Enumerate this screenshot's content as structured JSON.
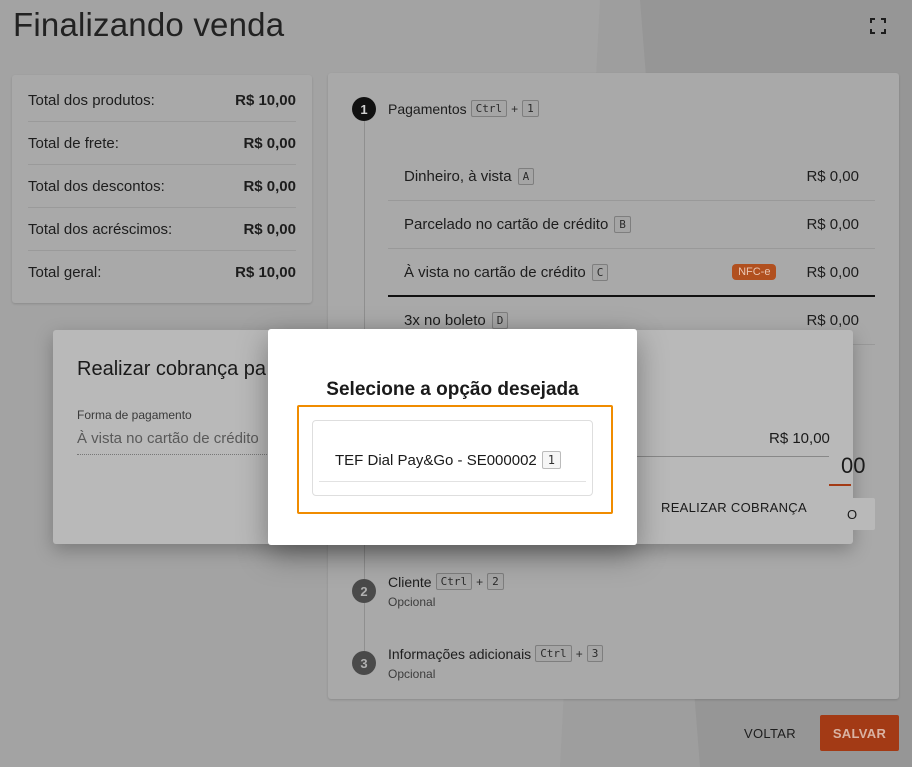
{
  "page": {
    "title": "Finalizando venda"
  },
  "summary": {
    "rows": [
      {
        "label": "Total dos produtos:",
        "value": "R$ 10,00"
      },
      {
        "label": "Total de frete:",
        "value": "R$ 0,00"
      },
      {
        "label": "Total dos descontos:",
        "value": "R$ 0,00"
      },
      {
        "label": "Total dos acréscimos:",
        "value": "R$ 0,00"
      },
      {
        "label": "Total geral:",
        "value": "R$ 10,00"
      }
    ]
  },
  "steps": {
    "payments": {
      "number": "1",
      "title": "Pagamentos",
      "shortcut_key": "Ctrl",
      "shortcut_plus": "+",
      "shortcut_num": "1"
    },
    "client": {
      "number": "2",
      "title": "Cliente",
      "shortcut_key": "Ctrl",
      "shortcut_plus": "+",
      "shortcut_num": "2",
      "subtitle": "Opcional"
    },
    "additional": {
      "number": "3",
      "title": "Informações adicionais",
      "shortcut_key": "Ctrl",
      "shortcut_plus": "+",
      "shortcut_num": "3",
      "subtitle": "Opcional"
    }
  },
  "payment_methods": [
    {
      "label": "Dinheiro, à vista",
      "key": "A",
      "amount": "R$ 0,00"
    },
    {
      "label": "Parcelado no cartão de crédito",
      "key": "B",
      "amount": "R$ 0,00"
    },
    {
      "label": "À vista no cartão de crédito",
      "key": "C",
      "amount": "R$ 0,00",
      "badge": "NFC-e"
    },
    {
      "label": "3x no boleto",
      "key": "D",
      "amount": "R$ 0,00"
    }
  ],
  "charge_dialog": {
    "title": "Realizar cobrança pa",
    "field_label": "Forma de pagamento",
    "field_value": "À vista no cartão de crédito",
    "amount": "R$ 10,00",
    "peek_value": "00",
    "peek_btn": "O",
    "action": "REALIZAR COBRANÇA"
  },
  "select_modal": {
    "title": "Selecione a opção desejada",
    "option_label": "TEF Dial Pay&Go - SE000002",
    "option_key": "1"
  },
  "footer": {
    "back": "VOLTAR",
    "save": "SALVAR"
  },
  "colors": {
    "accent": "#c8481c",
    "highlight": "#f08c00",
    "badge": "#d26a34"
  }
}
